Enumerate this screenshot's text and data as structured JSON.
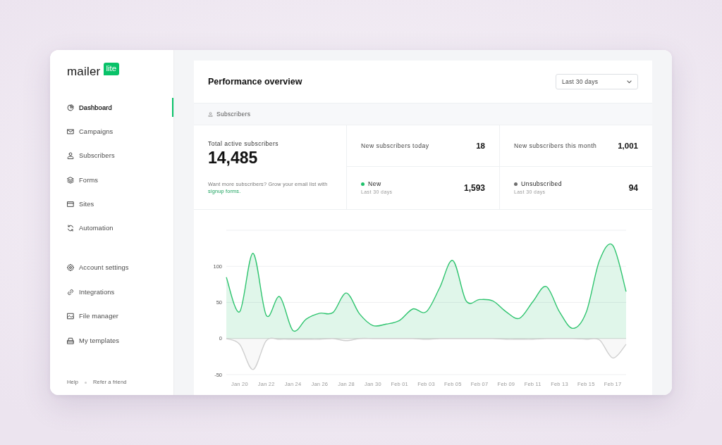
{
  "sidebar": {
    "logo": {
      "wordmark": "mailer",
      "badge": "lite"
    },
    "nav": [
      {
        "label": "Dashboard",
        "selected": true
      },
      {
        "label": "Campaigns",
        "selected": false
      },
      {
        "label": "Subscribers",
        "selected": false
      },
      {
        "label": "Forms",
        "selected": false
      },
      {
        "label": "Sites",
        "selected": false
      },
      {
        "label": "Automation",
        "selected": false
      }
    ],
    "settings": [
      {
        "label": "Account settings",
        "selected": false
      },
      {
        "label": "Integrations",
        "selected": false
      },
      {
        "label": "File manager",
        "selected": false
      },
      {
        "label": "My templates",
        "selected": false
      }
    ],
    "footer_links": [
      "Help",
      "Refer a friend"
    ]
  },
  "panel": {
    "title": "Performance overview",
    "date_range": {
      "value": "Last 30 days"
    },
    "section": {
      "label": "Subscribers"
    },
    "total": {
      "label": "Total active subscribers",
      "value": "14,485",
      "hint": "Want more subscribers? Grow your email list with",
      "hint_link": "signup forms."
    },
    "counters": [
      {
        "label": "New subscribers today",
        "value": "18"
      },
      {
        "label": "New subscribers this month",
        "value": "1,001"
      }
    ],
    "breakdown": [
      {
        "label": "New",
        "sublabel": "Last 30 days",
        "value": "1,593",
        "color": "#1fc16b"
      },
      {
        "label": "Unsubscribed",
        "sublabel": "Last 30 days",
        "value": "94",
        "color": "#6e6e6e"
      }
    ],
    "chart_data": {
      "type": "area",
      "categories": [
        null,
        "Jan 20",
        null,
        "Jan 22",
        null,
        "Jan 24",
        null,
        "Jan 26",
        null,
        "Jan 28",
        null,
        "Jan 30",
        null,
        "Feb 01",
        null,
        "Feb 03",
        null,
        "Feb 05",
        null,
        "Feb 07",
        null,
        "Feb 09",
        null,
        "Feb 11",
        null,
        "Feb 13",
        null,
        "Feb 15",
        null,
        "Feb 17",
        null
      ],
      "ylim": [
        -50,
        150
      ],
      "yticks": [
        -50,
        0,
        50,
        100
      ],
      "series": [
        {
          "color": "#2fc46f",
          "values": [
            85,
            37,
            118,
            32,
            58,
            11,
            27,
            35,
            36,
            63,
            34,
            18,
            20,
            25,
            41,
            37,
            70,
            108,
            52,
            54,
            52,
            37,
            28,
            51,
            72,
            37,
            14,
            36,
            108,
            129,
            65
          ]
        },
        {
          "color": "#cfcfcf",
          "values": [
            0,
            -8,
            -43,
            -3,
            -1,
            -1,
            -1,
            -1,
            0,
            -3,
            0,
            0,
            0,
            0,
            0,
            -1,
            0,
            0,
            0,
            0,
            0,
            -1,
            -1,
            -1,
            0,
            0,
            0,
            -1,
            -2,
            -27,
            -8
          ]
        }
      ]
    }
  }
}
